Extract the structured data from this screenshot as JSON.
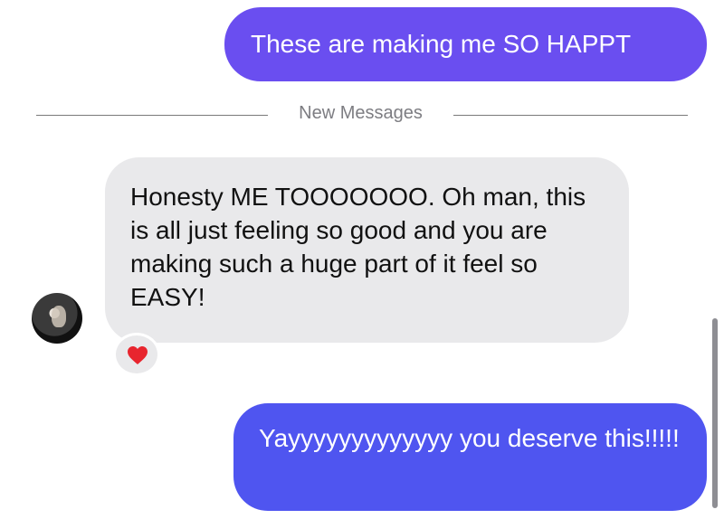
{
  "messages": {
    "outgoing_1": "These are making me SO HAPPT",
    "divider_label": "New Messages",
    "incoming_1": "Honesty ME TOOOOOOO. Oh man, this is all just feeling so good and you are making such a huge part of it feel so EASY!",
    "reaction": "heart",
    "outgoing_2": "Yayyyyyyyyyyyyy you deserve this!!!!!"
  },
  "colors": {
    "outgoing_bubble_top": "#6a4ef0",
    "outgoing_bubble_bottom": "#4f55f0",
    "incoming_bubble": "#e9e9eb",
    "divider_text": "#7d7d82",
    "heart": "#e8252e"
  },
  "icons": {
    "reaction_icon": "red-heart-icon",
    "avatar": "contact-avatar"
  }
}
